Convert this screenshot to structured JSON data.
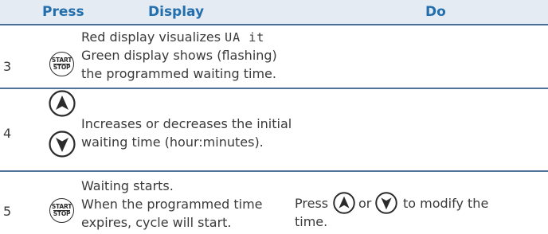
{
  "header": {
    "press": "Press",
    "display": "Display",
    "do": "Do"
  },
  "rows": [
    {
      "number": "3",
      "button": {
        "top": "START",
        "bottom": "STOP"
      },
      "display_lines": [
        "Red display visualizes",
        "Green display shows (flashing)",
        "the programmed waiting time."
      ],
      "segment_text": "UA it"
    },
    {
      "number": "4",
      "display_lines": [
        "Increases or decreases the initial",
        "waiting time (hour:minutes)."
      ]
    },
    {
      "number": "5",
      "button": {
        "top": "START",
        "bottom": "STOP"
      },
      "display_lines": [
        "Waiting starts.",
        "When the programmed time",
        "expires, cycle will start."
      ],
      "do": {
        "press": "Press",
        "or": "or",
        "to_modify": "to modify the",
        "time": "time."
      }
    }
  ]
}
